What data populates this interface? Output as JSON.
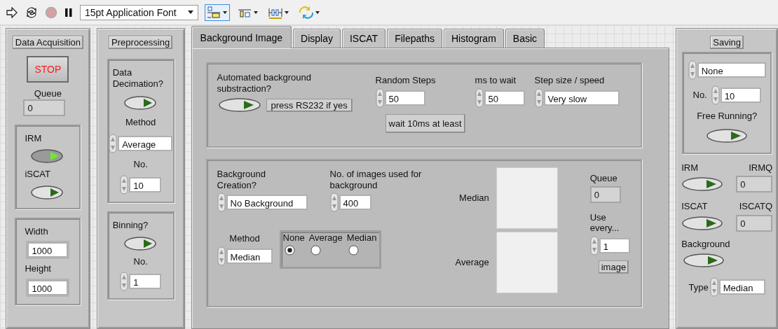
{
  "toolbar": {
    "font": "15pt Application Font"
  },
  "acquisition": {
    "title": "Data Acquisition",
    "stop": "STOP",
    "queue": {
      "label": "Queue",
      "value": "0"
    },
    "toggles": [
      {
        "label": "IRM",
        "on": true
      },
      {
        "label": "iSCAT",
        "on": false
      }
    ],
    "size": [
      {
        "label": "Width",
        "value": "1000"
      },
      {
        "label": "Height",
        "value": "1000"
      }
    ]
  },
  "preprocessing": {
    "title": "Preprocessing",
    "decimation": {
      "label": "Data Decimation?",
      "on": false
    },
    "method": {
      "label": "Method",
      "value": "Average"
    },
    "count": {
      "label": "No.",
      "value": "10"
    },
    "binning": {
      "label": "Binning?",
      "on": false
    },
    "binning_count": {
      "label": "No.",
      "value": "1"
    }
  },
  "tabs": [
    {
      "label": "Background Image",
      "selected": true
    },
    {
      "label": "Display",
      "selected": false
    },
    {
      "label": "ISCAT",
      "selected": false
    },
    {
      "label": "Filepaths",
      "selected": false
    },
    {
      "label": "Histogram",
      "selected": false
    },
    {
      "label": "Basic",
      "selected": false
    }
  ],
  "automation": {
    "label": "Automated background substraction?",
    "on": false,
    "note": "press RS232 if yes",
    "random_steps": {
      "label": "Random Steps",
      "value": "50"
    },
    "ms_to_wait": {
      "label": "ms to wait",
      "value": "50"
    },
    "wait_note": "wait 10ms at least",
    "step_size": {
      "label": "Step size / speed",
      "value": "Very slow"
    }
  },
  "background": {
    "creation": {
      "label": "Background Creation?",
      "value": "No Background"
    },
    "images": {
      "label": "No. of images used for background",
      "value": "400"
    },
    "method": {
      "label": "Method",
      "value": "Median"
    },
    "radio": [
      {
        "label": "None",
        "selected": true
      },
      {
        "label": "Average",
        "selected": false
      },
      {
        "label": "Median",
        "selected": false
      }
    ],
    "displays": [
      {
        "label": "Median"
      },
      {
        "label": "Average"
      }
    ],
    "queue": {
      "label": "Queue",
      "value": "0"
    },
    "use_every": {
      "label": "Use every...",
      "value": "1"
    },
    "unit": "image"
  },
  "saving": {
    "title": "Saving",
    "mode": "None",
    "count": {
      "label": "No.",
      "value": "10"
    },
    "free_running": {
      "label": "Free Running?",
      "on": false
    },
    "queues": [
      {
        "label": "IRM",
        "on": false,
        "queue_label": "IRMQ",
        "value": "0"
      },
      {
        "label": "ISCAT",
        "on": false,
        "queue_label": "ISCATQ",
        "value": "0"
      }
    ],
    "background": {
      "label": "Background",
      "on": false
    },
    "type": {
      "label": "Type",
      "value": "Median"
    }
  }
}
